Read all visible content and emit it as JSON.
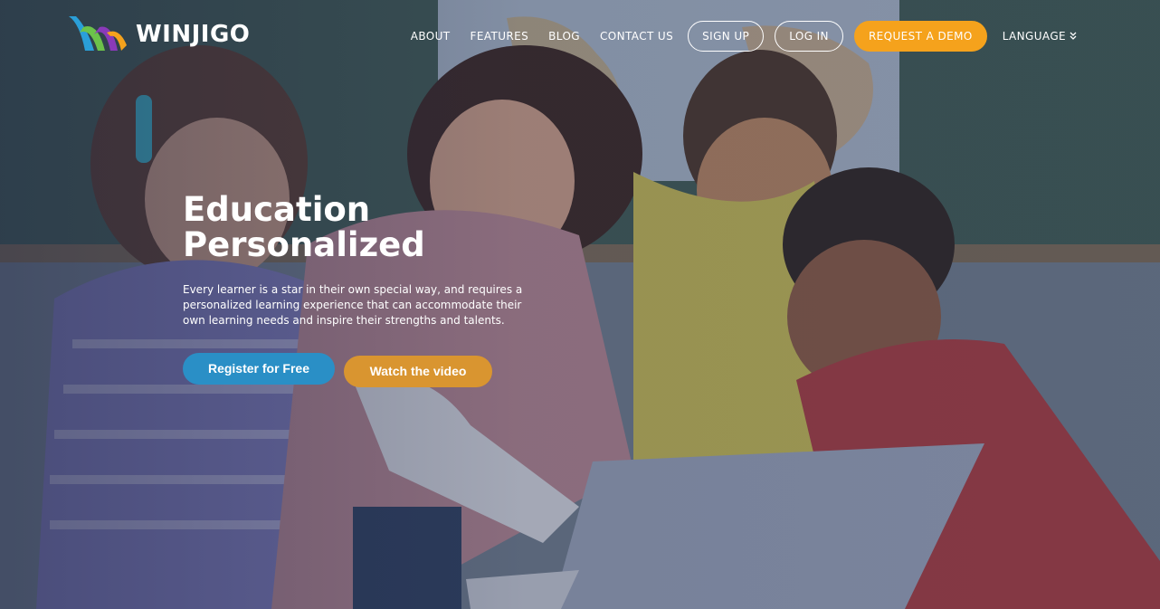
{
  "brand": {
    "name": "WINJIGO",
    "colors": {
      "blue": "#2a8fc6",
      "orange": "#f5a21c",
      "green": "#6cc24a",
      "purple": "#8a3ab9"
    }
  },
  "nav": {
    "items": [
      "ABOUT",
      "FEATURES",
      "BLOG",
      "CONTACT US"
    ],
    "signup": "SIGN UP",
    "login": "LOG IN",
    "demo": "REQUEST A DEMO",
    "language": "LANGUAGE"
  },
  "hero": {
    "title_line1": "Education",
    "title_line2": "Personalized",
    "text_line1": "Every learner is a star in their own special way, and requires a",
    "text_line2": "personalized learning experience that can accommodate their",
    "text_line3": "own learning needs and inspire their strengths and talents.",
    "register_label": "Register for Free",
    "video_label": "Watch the video",
    "background_photo": "teacher-with-students-at-laptop-photo"
  },
  "icons": {
    "language_chevron": "double-chevron-down-icon"
  }
}
